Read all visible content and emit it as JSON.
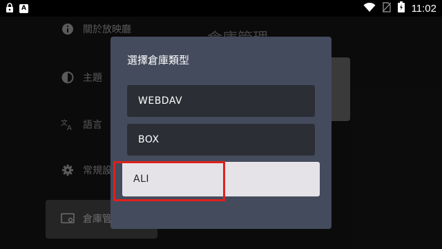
{
  "status_bar": {
    "left_icons": [
      "lock-icon",
      "a-icon"
    ],
    "a_icon_letter": "A",
    "right_icons": [
      "wifi-icon",
      "no-sim-icon",
      "battery-charging-icon"
    ],
    "time": "11:02"
  },
  "background": {
    "page_title": "倉庫管理",
    "nav_items": [
      {
        "icon": "info-icon",
        "label": "關於放映廳"
      },
      {
        "icon": "theme-icon",
        "label": "主題"
      },
      {
        "icon": "translate-icon",
        "label": "語言"
      },
      {
        "icon": "gear-icon",
        "label": "常規設"
      },
      {
        "icon": "storage-icon",
        "label": "倉庫管",
        "selected": true
      }
    ]
  },
  "dialog": {
    "title": "選擇倉庫類型",
    "options": [
      {
        "label": "WEBDAV"
      },
      {
        "label": "BOX"
      },
      {
        "label": "ALI",
        "selected": true
      }
    ]
  },
  "colors": {
    "dialog_bg": "#444b5d",
    "option_bg": "#2b2e35",
    "selected_bg": "#e6e3e8",
    "highlight": "#e0201b"
  }
}
